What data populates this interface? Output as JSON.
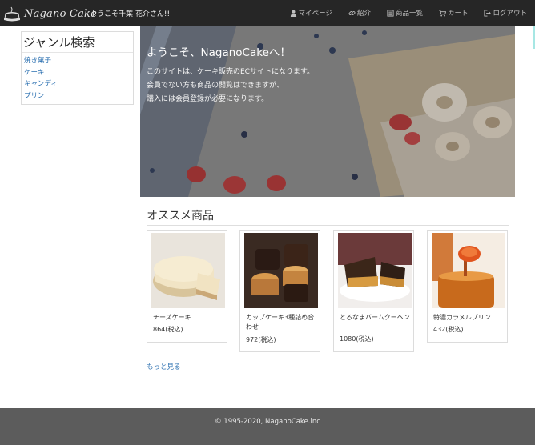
{
  "header": {
    "brand_name": "Nagano Cake",
    "welcome": "ようこそ千葉 花介さん!!",
    "nav": [
      {
        "label": "マイページ",
        "icon": "user-icon"
      },
      {
        "label": "紹介",
        "icon": "link-icon"
      },
      {
        "label": "商品一覧",
        "icon": "list-icon"
      },
      {
        "label": "カート",
        "icon": "cart-icon"
      },
      {
        "label": "ログアウト",
        "icon": "logout-icon"
      }
    ]
  },
  "sidebar": {
    "title": "ジャンル検索",
    "genres": [
      "焼き菓子",
      "ケーキ",
      "キャンディ",
      "プリン"
    ]
  },
  "hero": {
    "title": "ようこそ、NaganoCakeへ！",
    "lines": [
      "このサイトは、ケーキ販売のECサイトになります。",
      "会員でない方も商品の閲覧はできますが、",
      "購入には会員登録が必要になります。"
    ]
  },
  "recommended": {
    "title": "オススメ商品",
    "items": [
      {
        "name": "チーズケーキ",
        "price": "864(税込)"
      },
      {
        "name": "カップケーキ3種詰め合わせ",
        "price": "972(税込)"
      },
      {
        "name": "とろなまバームクーヘン",
        "price": "1080(税込)"
      },
      {
        "name": "特濃カラメルプリン",
        "price": "432(税込)"
      }
    ],
    "more_label": "もっと見る"
  },
  "footer": {
    "copyright": "© 1995-2020, NaganoCake.inc"
  },
  "colors": {
    "header_bg": "#262626",
    "footer_bg": "#5c5c5c",
    "link": "#2a6fb0"
  }
}
